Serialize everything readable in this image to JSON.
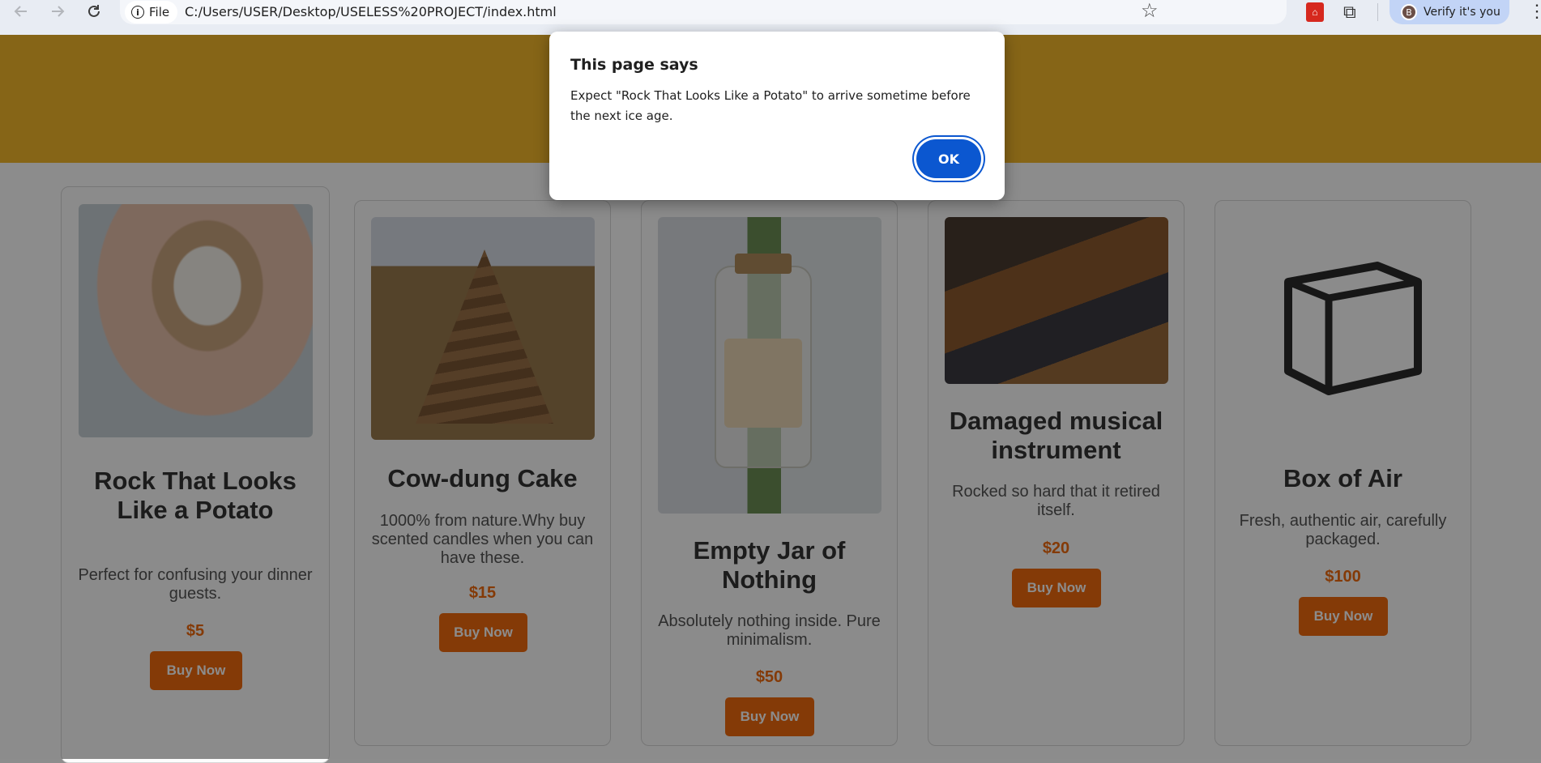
{
  "browser": {
    "back_icon": "arrow-left-icon",
    "forward_icon": "arrow-right-icon",
    "reload_icon": "reload-icon",
    "file_chip": "File",
    "url": "C:/Users/USER/Desktop/USELESS%20PROJECT/index.html",
    "profile_initial": "B",
    "verify_label": "Verify it's you"
  },
  "dialog": {
    "title": "This page says",
    "message": "Expect \"Rock That Looks Like a Potato\" to arrive sometime before the next ice age.",
    "ok_label": "OK"
  },
  "products": [
    {
      "name": "Rock That Looks Like a Potato",
      "description": "Perfect for confusing your dinner guests.",
      "price": "$5",
      "button": "Buy Now"
    },
    {
      "name": "Cow-dung Cake",
      "description": "1000% from nature.Why buy scented candles when you can have these.",
      "price": "$15",
      "button": "Buy Now"
    },
    {
      "name": "Empty Jar of Nothing",
      "description": "Absolutely nothing inside. Pure minimalism.",
      "price": "$50",
      "button": "Buy Now"
    },
    {
      "name": "Damaged musical instrument",
      "description": "Rocked so hard that it retired itself.",
      "price": "$20",
      "button": "Buy Now"
    },
    {
      "name": "Box of Air",
      "description": "Fresh, authentic air, carefully packaged.",
      "price": "$100",
      "button": "Buy Now"
    }
  ],
  "colors": {
    "banner": "#f5b92a",
    "accent": "#f06a0e",
    "dialog_button": "#0b57d0"
  }
}
